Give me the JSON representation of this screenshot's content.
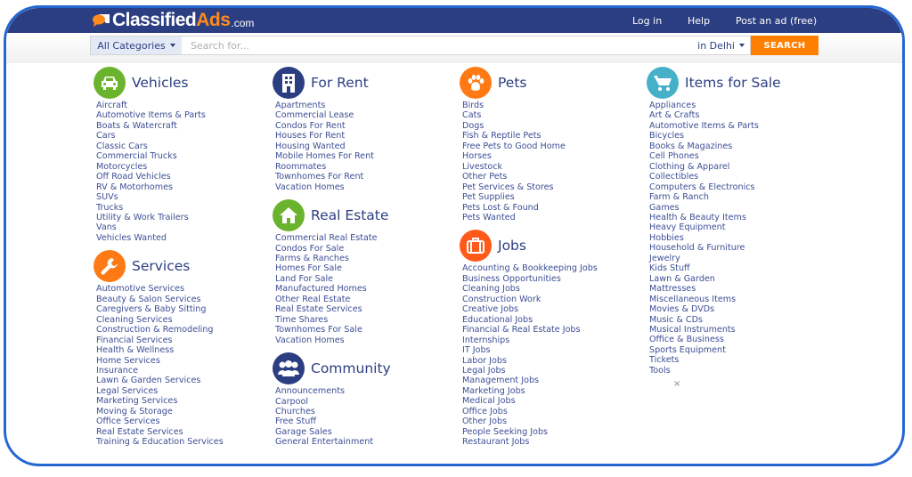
{
  "header": {
    "logo": {
      "part1": "Classified",
      "part2": "Ads",
      "suffix": ".com"
    },
    "nav": {
      "login": "Log in",
      "help": "Help",
      "post_ad": "Post an ad (free)"
    }
  },
  "search": {
    "category_label": "All Categories",
    "placeholder": "Search for...",
    "value": "",
    "location_label": "in Delhi",
    "button_label": "SEARCH"
  },
  "colors": {
    "brand_navy": "#2c3e82",
    "accent_orange": "#ff8000",
    "link_blue": "#3d4f96",
    "icon_green": "#6ab42d",
    "icon_orange": "#ff7a15",
    "icon_navy": "#2c3e82",
    "icon_teal": "#47b0c9",
    "frame_blue": "#2567d0"
  },
  "categories": {
    "vehicles": {
      "title": "Vehicles",
      "icon": "car-icon",
      "items": [
        "Aircraft",
        "Automotive Items & Parts",
        "Boats & Watercraft",
        "Cars",
        "Classic Cars",
        "Commercial Trucks",
        "Motorcycles",
        "Off Road Vehicles",
        "RV & Motorhomes",
        "SUVs",
        "Trucks",
        "Utility & Work Trailers",
        "Vans",
        "Vehicles Wanted"
      ]
    },
    "services": {
      "title": "Services",
      "icon": "wrench-icon",
      "items": [
        "Automotive Services",
        "Beauty & Salon Services",
        "Caregivers & Baby Sitting",
        "Cleaning Services",
        "Construction & Remodeling",
        "Financial Services",
        "Health & Wellness",
        "Home Services",
        "Insurance",
        "Lawn & Garden Services",
        "Legal Services",
        "Marketing Services",
        "Moving & Storage",
        "Office Services",
        "Real Estate Services",
        "Training & Education Services"
      ]
    },
    "for_rent": {
      "title": "For Rent",
      "icon": "building-icon",
      "items": [
        "Apartments",
        "Commercial Lease",
        "Condos For Rent",
        "Houses For Rent",
        "Housing Wanted",
        "Mobile Homes For Rent",
        "Roommates",
        "Townhomes For Rent",
        "Vacation Homes"
      ]
    },
    "real_estate": {
      "title": "Real Estate",
      "icon": "house-icon",
      "items": [
        "Commercial Real Estate",
        "Condos For Sale",
        "Farms & Ranches",
        "Homes For Sale",
        "Land For Sale",
        "Manufactured Homes",
        "Other Real Estate",
        "Real Estate Services",
        "Time Shares",
        "Townhomes For Sale",
        "Vacation Homes"
      ]
    },
    "community": {
      "title": "Community",
      "icon": "people-icon",
      "items": [
        "Announcements",
        "Carpool",
        "Churches",
        "Free Stuff",
        "Garage Sales",
        "General Entertainment"
      ]
    },
    "pets": {
      "title": "Pets",
      "icon": "paw-icon",
      "items": [
        "Birds",
        "Cats",
        "Dogs",
        "Fish & Reptile Pets",
        "Free Pets to Good Home",
        "Horses",
        "Livestock",
        "Other Pets",
        "Pet Services & Stores",
        "Pet Supplies",
        "Pets Lost & Found",
        "Pets Wanted"
      ]
    },
    "jobs": {
      "title": "Jobs",
      "icon": "briefcase-icon",
      "items": [
        "Accounting & Bookkeeping Jobs",
        "Business Opportunities",
        "Cleaning Jobs",
        "Construction Work",
        "Creative Jobs",
        "Educational Jobs",
        "Financial & Real Estate Jobs",
        "Internships",
        "IT Jobs",
        "Labor Jobs",
        "Legal Jobs",
        "Management Jobs",
        "Marketing Jobs",
        "Medical Jobs",
        "Office Jobs",
        "Other Jobs",
        "People Seeking Jobs",
        "Restaurant Jobs"
      ]
    },
    "items_for_sale": {
      "title": "Items for Sale",
      "icon": "cart-icon",
      "items": [
        "Appliances",
        "Art & Crafts",
        "Automotive Items & Parts",
        "Bicycles",
        "Books & Magazines",
        "Cell Phones",
        "Clothing & Apparel",
        "Collectibles",
        "Computers & Electronics",
        "Farm & Ranch",
        "Games",
        "Health & Beauty Items",
        "Heavy Equipment",
        "Hobbies",
        "Household & Furniture",
        "Jewelry",
        "Kids Stuff",
        "Lawn & Garden",
        "Mattresses",
        "Miscellaneous Items",
        "Movies & DVDs",
        "Music & CDs",
        "Musical Instruments",
        "Office & Business",
        "Sports Equipment",
        "Tickets",
        "Tools"
      ]
    }
  },
  "close_glyph": "×"
}
